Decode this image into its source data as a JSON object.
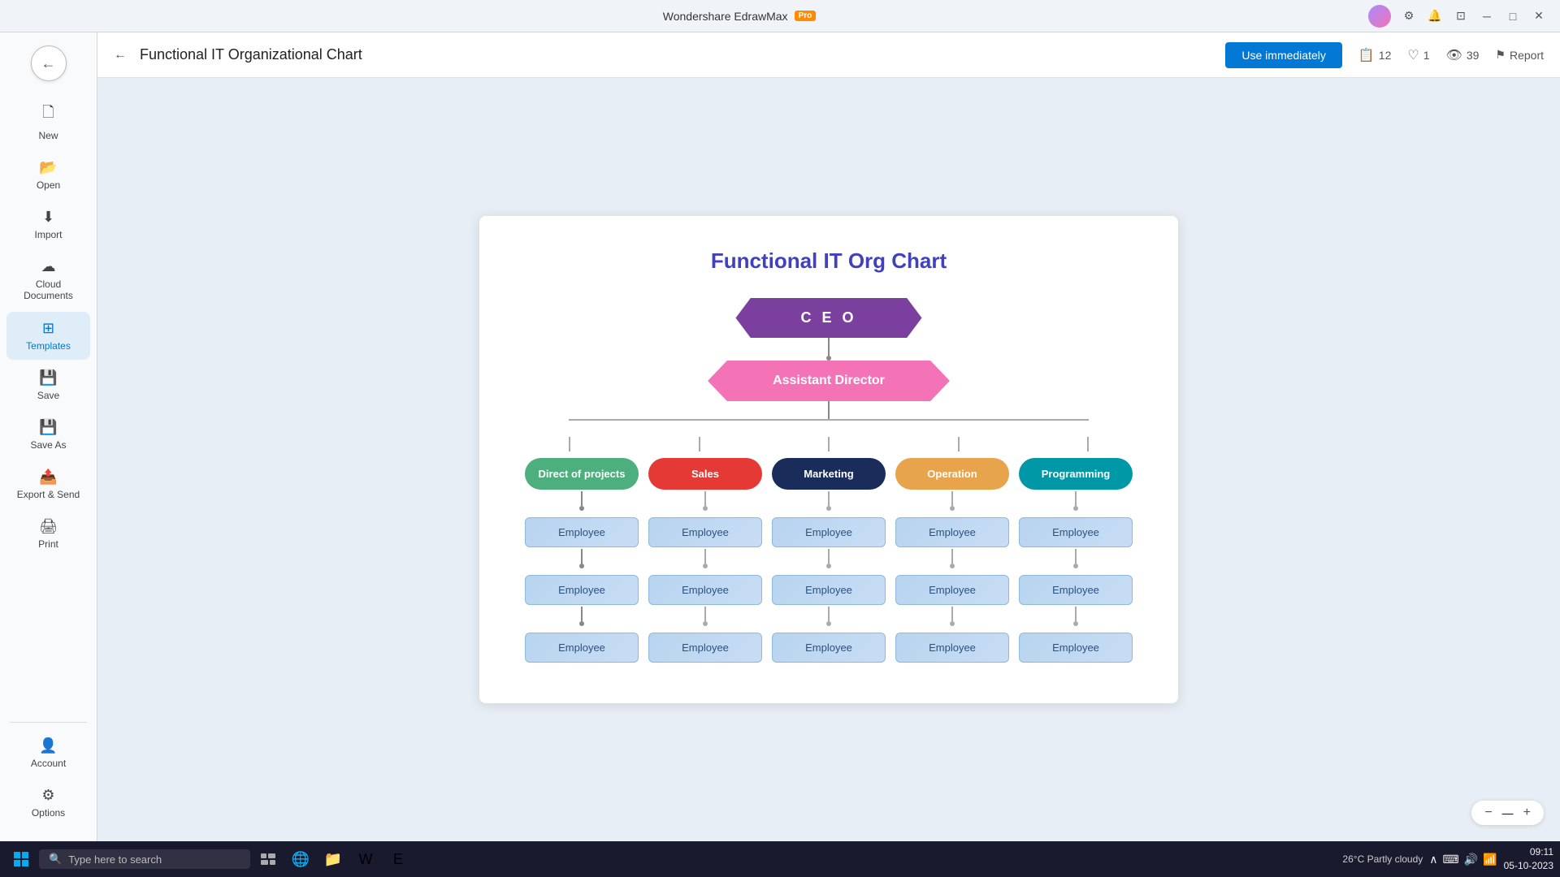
{
  "titleBar": {
    "appName": "Wondershare EdrawMax",
    "proBadge": "Pro"
  },
  "header": {
    "backArrow": "←",
    "title": "Functional IT Organizational Chart",
    "useImmediatelyLabel": "Use immediately",
    "stats": [
      {
        "icon": "📋",
        "value": "12"
      },
      {
        "icon": "♡",
        "value": "1"
      },
      {
        "icon": "👁",
        "value": "39"
      }
    ],
    "reportLabel": "Report"
  },
  "sidebar": {
    "items": [
      {
        "id": "new",
        "icon": "✚",
        "label": "New"
      },
      {
        "id": "open",
        "icon": "📂",
        "label": "Open"
      },
      {
        "id": "import",
        "icon": "⬇",
        "label": "Import"
      },
      {
        "id": "cloud",
        "icon": "☁",
        "label": "Cloud Documents"
      },
      {
        "id": "templates",
        "icon": "⊞",
        "label": "Templates"
      },
      {
        "id": "save",
        "icon": "💾",
        "label": "Save"
      },
      {
        "id": "saveas",
        "icon": "💾",
        "label": "Save As"
      },
      {
        "id": "export",
        "icon": "📤",
        "label": "Export & Send"
      },
      {
        "id": "print",
        "icon": "🖨",
        "label": "Print"
      }
    ],
    "bottomItems": [
      {
        "id": "account",
        "icon": "👤",
        "label": "Account"
      },
      {
        "id": "options",
        "icon": "⚙",
        "label": "Options"
      }
    ]
  },
  "chart": {
    "title": "Functional IT Org Chart",
    "ceo": "C E O",
    "assistantDirector": "Assistant Director",
    "departments": [
      {
        "label": "Direct of projects",
        "color": "dept-green"
      },
      {
        "label": "Sales",
        "color": "dept-red"
      },
      {
        "label": "Marketing",
        "color": "dept-navy"
      },
      {
        "label": "Operation",
        "color": "dept-orange"
      },
      {
        "label": "Programming",
        "color": "dept-teal"
      }
    ],
    "employeeLabel": "Employee",
    "rows": 3
  },
  "zoom": {
    "minus": "−",
    "value": "—",
    "plus": "+"
  },
  "taskbar": {
    "searchPlaceholder": "Type here to search",
    "weather": "26°C  Partly cloudy",
    "time": "09:11",
    "date": "05-10-2023"
  }
}
